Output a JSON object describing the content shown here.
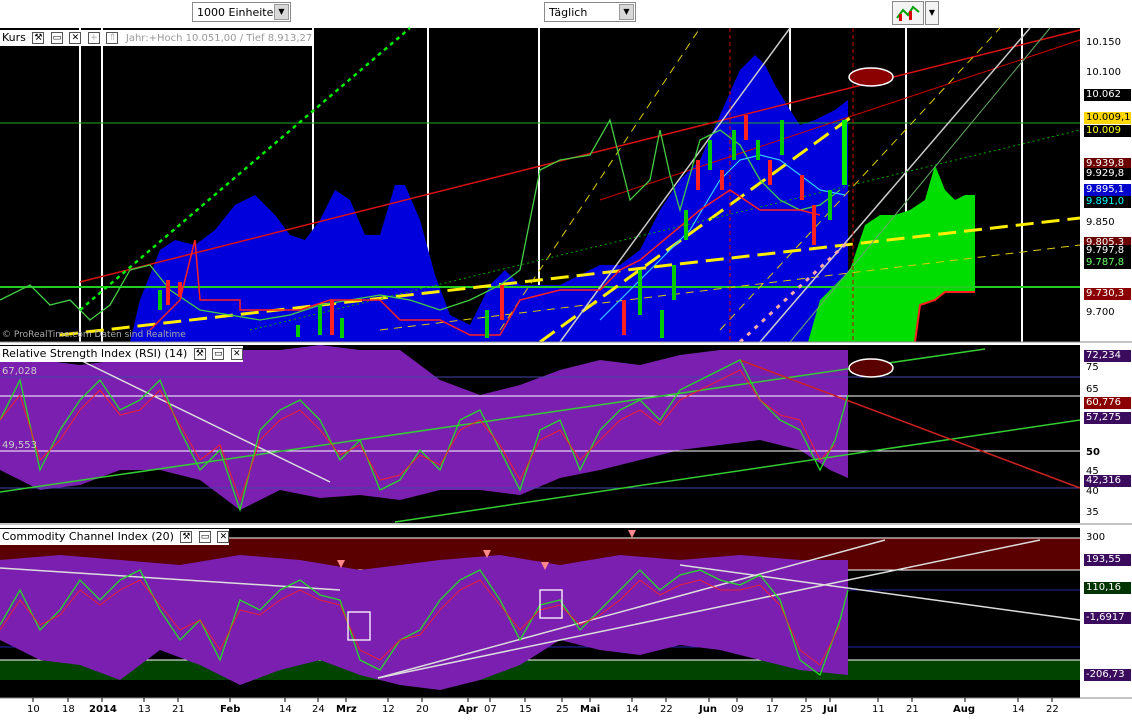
{
  "toolbar": {
    "units_select": "1000 Einheiten",
    "timeframe_select": "Täglich",
    "chart_type_icon": "chart-type-icon"
  },
  "price_panel": {
    "title": "Kurs",
    "info": "Jahr:+Hoch 10.051,00 / Tief 8.913,27",
    "watermark": "© ProRealTime.com Daten sind Realtime",
    "axis_ticks": [
      "10.150",
      "10.100",
      "10.050",
      "10.000",
      "9.950",
      "9.900",
      "9.850",
      "9.800",
      "9.750",
      "9.700"
    ],
    "tags": [
      {
        "text": "10.062",
        "bg": "#000000",
        "fg": "#ffffff"
      },
      {
        "text": "10.009,10",
        "bg": "#ffd700",
        "fg": "#000000"
      },
      {
        "text": "10.009",
        "bg": "#000000",
        "fg": "#ffff00"
      },
      {
        "text": "9.939,8",
        "bg": "#6b0000",
        "fg": "#ffffff"
      },
      {
        "text": "9.929,8",
        "bg": "#000000",
        "fg": "#ffffff"
      },
      {
        "text": "9.895,1",
        "bg": "#0000cc",
        "fg": "#ffffff"
      },
      {
        "text": "9.891,0",
        "bg": "#000000",
        "fg": "#00ffff"
      },
      {
        "text": "9.805,3",
        "bg": "#6b0000",
        "fg": "#ffffff"
      },
      {
        "text": "9.797,8",
        "bg": "#000000",
        "fg": "#ffffff"
      },
      {
        "text": "9.787,8",
        "bg": "#000000",
        "fg": "#66ff66"
      },
      {
        "text": "9.730,3",
        "bg": "#8b0000",
        "fg": "#ffffff"
      }
    ]
  },
  "rsi_panel": {
    "title": "Relative Strength Index (RSI) (14)",
    "upper_label": "67,028",
    "lower_label": "49,553",
    "axis_ticks": [
      "75",
      "70",
      "65",
      "60",
      "55",
      "50",
      "45",
      "40",
      "35"
    ],
    "tags": [
      {
        "text": "72,234",
        "bg": "#3b0b5e",
        "fg": "#ffffff"
      },
      {
        "text": "60,776",
        "bg": "#8b0000",
        "fg": "#ffffff"
      },
      {
        "text": "57,275",
        "bg": "#3b0b5e",
        "fg": "#ffffff"
      },
      {
        "text": "42,316",
        "bg": "#3b0b5e",
        "fg": "#ffffff"
      }
    ]
  },
  "cci_panel": {
    "title": "Commodity Channel Index (20)",
    "axis_ticks": [
      "300"
    ],
    "tags": [
      {
        "text": "193,55",
        "bg": "#3b0b5e",
        "fg": "#ffffff"
      },
      {
        "text": "110,16",
        "bg": "#003300",
        "fg": "#ffffff"
      },
      {
        "text": "-1,6917",
        "bg": "#3b0b5e",
        "fg": "#ffffff"
      },
      {
        "text": "-206,73",
        "bg": "#3b0b5e",
        "fg": "#ffffff"
      }
    ]
  },
  "x_axis": [
    "10",
    "18",
    "2014",
    "13",
    "21",
    "Feb",
    "14",
    "24",
    "Mrz",
    "12",
    "20",
    "Apr",
    "07",
    "15",
    "25",
    "Mai",
    "14",
    "22",
    "Jun",
    "09",
    "17",
    "25",
    "Jul",
    "11",
    "21",
    "Aug",
    "14",
    "22"
  ],
  "colors": {
    "panel_bg": "#000000",
    "cloud_blue": "#0000dd",
    "cloud_green": "#00dd00",
    "band_purple": "#7a1fb0",
    "cci_red_zone": "#5a0000",
    "cci_green_zone": "#004400"
  }
}
